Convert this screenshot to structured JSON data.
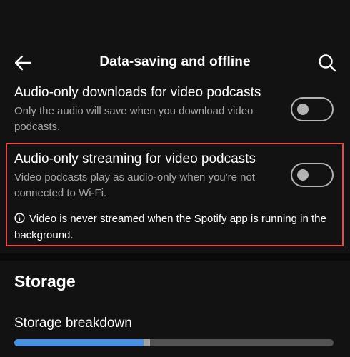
{
  "header": {
    "title": "Data-saving and offline",
    "back_icon": "arrow-left-icon",
    "search_icon": "search-icon"
  },
  "settings": [
    {
      "label": "Audio-only downloads for video podcasts",
      "description": "Only the audio will save when you download video podcasts.",
      "enabled": false
    },
    {
      "label": "Audio-only streaming for video podcasts",
      "description": "Video podcasts play as audio-only when you're not connected to Wi-Fi.",
      "enabled": false
    }
  ],
  "note": {
    "icon": "info-icon",
    "text": "Video is never streamed when the Spotify app is running in the background."
  },
  "storage": {
    "section_title": "Storage",
    "breakdown_label": "Storage breakdown",
    "used_fraction": 0.405,
    "other_fraction": 0.02
  },
  "colors": {
    "background": "#121212",
    "highlight": "#e54b4b",
    "bar_used": "#4a90e2",
    "bar_other": "#a0a0a0",
    "bar_track": "#535353"
  }
}
